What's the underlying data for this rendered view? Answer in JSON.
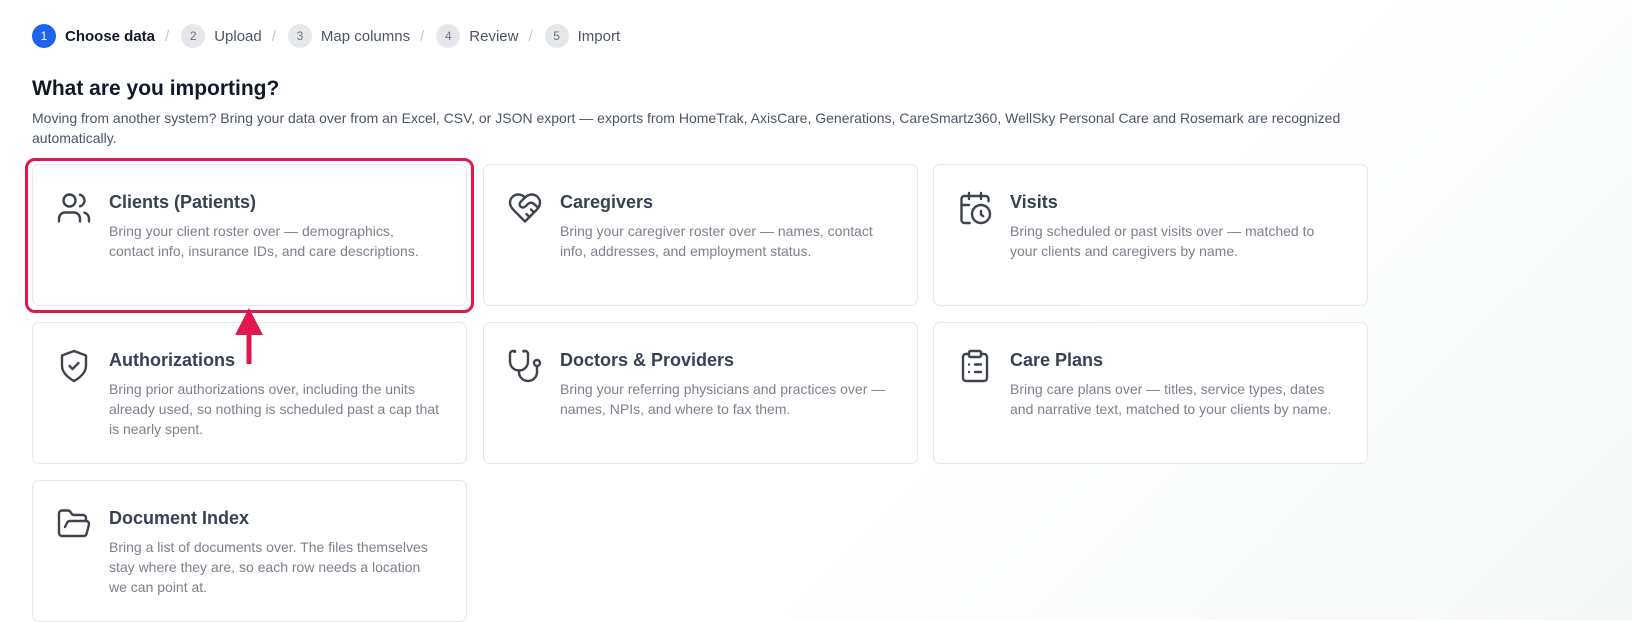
{
  "stepper": {
    "steps": [
      {
        "num": "1",
        "label": "Choose data"
      },
      {
        "num": "2",
        "label": "Upload"
      },
      {
        "num": "3",
        "label": "Map columns"
      },
      {
        "num": "4",
        "label": "Review"
      },
      {
        "num": "5",
        "label": "Import"
      }
    ],
    "separator": "/",
    "active_color": "#1d63ed"
  },
  "page": {
    "title": "What are you importing?",
    "intro": "Moving from another system? Bring your data over from an Excel, CSV, or JSON export — exports from HomeTrak, AxisCare, Generations, CareSmartz360, WellSky Personal Care and Rosemark are recognized automatically."
  },
  "cards": [
    {
      "title": "Clients (Patients)",
      "desc": "Bring your client roster over — demographics, contact info, insurance IDs, and care descriptions.",
      "icon": "users-icon"
    },
    {
      "title": "Caregivers",
      "desc": "Bring your caregiver roster over — names, contact info, addresses, and employment status.",
      "icon": "heart-handshake-icon"
    },
    {
      "title": "Visits",
      "desc": "Bring scheduled or past visits over — matched to your clients and caregivers by name.",
      "icon": "calendar-clock-icon"
    },
    {
      "title": "Authorizations",
      "desc": "Bring prior authorizations over, including the units already used, so nothing is scheduled past a cap that is nearly spent.",
      "icon": "shield-check-icon"
    },
    {
      "title": "Doctors & Providers",
      "desc": "Bring your referring physicians and practices over — names, NPIs, and where to fax them.",
      "icon": "stethoscope-icon"
    },
    {
      "title": "Care Plans",
      "desc": "Bring care plans over — titles, service types, dates and narrative text, matched to your clients by name.",
      "icon": "clipboard-list-icon"
    },
    {
      "title": "Document Index",
      "desc": "Bring a list of documents over. The files themselves stay where they are, so each row needs a location we can point at.",
      "icon": "folder-open-icon"
    }
  ],
  "annotation": {
    "color": "#e0184d",
    "target": "Clients (Patients)"
  }
}
